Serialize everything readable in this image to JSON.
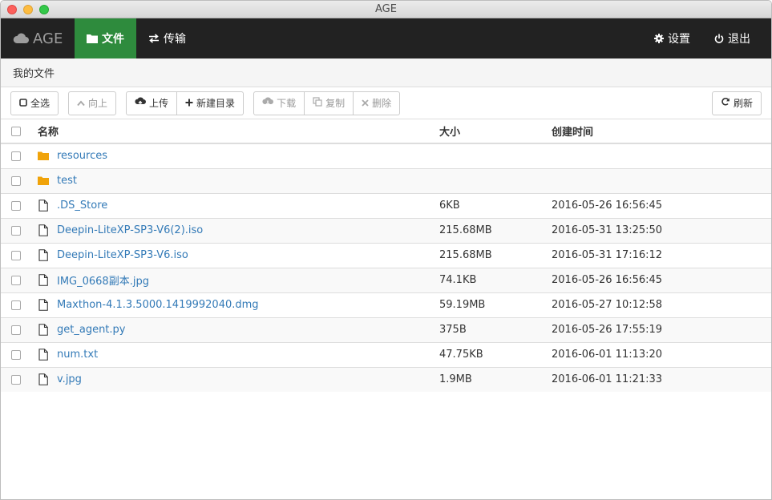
{
  "window": {
    "title": "AGE"
  },
  "navbar": {
    "brand": "AGE",
    "files_label": "文件",
    "transfer_label": "传输",
    "settings_label": "设置",
    "logout_label": "退出"
  },
  "breadcrumb": {
    "current": "我的文件"
  },
  "toolbar": {
    "select_all": "全选",
    "up": "向上",
    "upload": "上传",
    "new_folder": "新建目录",
    "download": "下载",
    "copy": "复制",
    "delete": "删除",
    "refresh": "刷新"
  },
  "table": {
    "headers": {
      "name": "名称",
      "size": "大小",
      "created": "创建时间"
    },
    "rows": [
      {
        "type": "folder",
        "name": "resources",
        "size": "",
        "created": ""
      },
      {
        "type": "folder",
        "name": "test",
        "size": "",
        "created": ""
      },
      {
        "type": "file",
        "name": ".DS_Store",
        "size": "6KB",
        "created": "2016-05-26 16:56:45"
      },
      {
        "type": "file",
        "name": "Deepin-LiteXP-SP3-V6(2).iso",
        "size": "215.68MB",
        "created": "2016-05-31 13:25:50"
      },
      {
        "type": "file",
        "name": "Deepin-LiteXP-SP3-V6.iso",
        "size": "215.68MB",
        "created": "2016-05-31 17:16:12"
      },
      {
        "type": "file",
        "name": "IMG_0668副本.jpg",
        "size": "74.1KB",
        "created": "2016-05-26 16:56:45"
      },
      {
        "type": "file",
        "name": "Maxthon-4.1.3.5000.1419992040.dmg",
        "size": "59.19MB",
        "created": "2016-05-27 10:12:58"
      },
      {
        "type": "file",
        "name": "get_agent.py",
        "size": "375B",
        "created": "2016-05-26 17:55:19"
      },
      {
        "type": "file",
        "name": "num.txt",
        "size": "47.75KB",
        "created": "2016-06-01 11:13:20"
      },
      {
        "type": "file",
        "name": "v.jpg",
        "size": "1.9MB",
        "created": "2016-06-01 11:21:33"
      }
    ]
  },
  "colors": {
    "navbar_bg": "#222222",
    "active_tab": "#2e8b3d",
    "link": "#337ab7",
    "folder_icon": "#f0a30a"
  }
}
